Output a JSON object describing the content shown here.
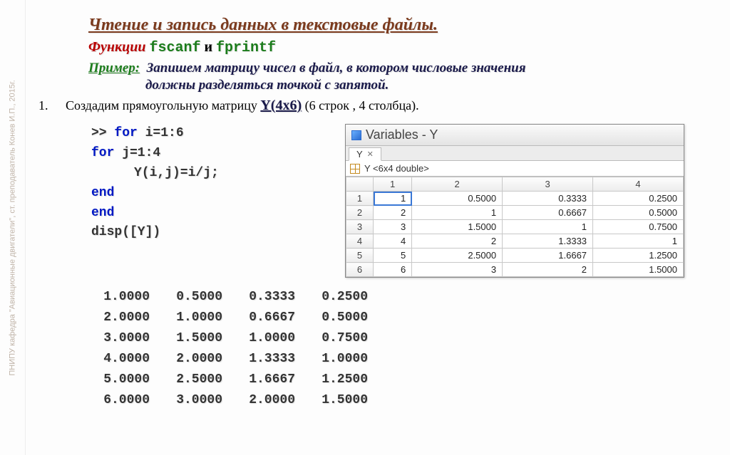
{
  "sidebar_caption": "ПНИПУ кафедра \"Авиационные двигатели\", ст. преподаватель Конев И.П., 2015г.",
  "title": "Чтение и запись данных в текстовые файлы.",
  "functions": {
    "label": "Функции",
    "f1": "fscanf",
    "and": "и",
    "f2": "fprintf"
  },
  "example": {
    "label": "Пример:",
    "text_line1": "Запишем  матрицу чисел в файл, в котором числовые значения",
    "text_line2": "должны разделяться точкой с запятой."
  },
  "step": {
    "num": "1.",
    "text_a": "Создадим  прямоугольную матрицу  ",
    "matrix": "Y(4x6)",
    "text_b": "   (6 строк , 4 столбца)."
  },
  "code": {
    "l1a": ">> ",
    "l1b": "for",
    "l1c": " i=1:6",
    "l2a": "for",
    "l2b": " j=1:4",
    "l3": "Y(i,j)=i/j;",
    "l4": "end",
    "l5": "end",
    "l6": "disp([Y])"
  },
  "output": [
    [
      "1.0000",
      "0.5000",
      "0.3333",
      "0.2500"
    ],
    [
      "2.0000",
      "1.0000",
      "0.6667",
      "0.5000"
    ],
    [
      "3.0000",
      "1.5000",
      "1.0000",
      "0.7500"
    ],
    [
      "4.0000",
      "2.0000",
      "1.3333",
      "1.0000"
    ],
    [
      "5.0000",
      "2.5000",
      "1.6667",
      "1.2500"
    ],
    [
      "6.0000",
      "3.0000",
      "2.0000",
      "1.5000"
    ]
  ],
  "var_window": {
    "title": "Variables - Y",
    "tab": "Y",
    "desc": "Y <6x4 double>",
    "headers": [
      "1",
      "2",
      "3",
      "4"
    ],
    "rows": [
      "1",
      "2",
      "3",
      "4",
      "5",
      "6"
    ],
    "data": [
      [
        "1",
        "0.5000",
        "0.3333",
        "0.2500"
      ],
      [
        "2",
        "1",
        "0.6667",
        "0.5000"
      ],
      [
        "3",
        "1.5000",
        "1",
        "0.7500"
      ],
      [
        "4",
        "2",
        "1.3333",
        "1"
      ],
      [
        "5",
        "2.5000",
        "1.6667",
        "1.2500"
      ],
      [
        "6",
        "3",
        "2",
        "1.5000"
      ]
    ]
  }
}
